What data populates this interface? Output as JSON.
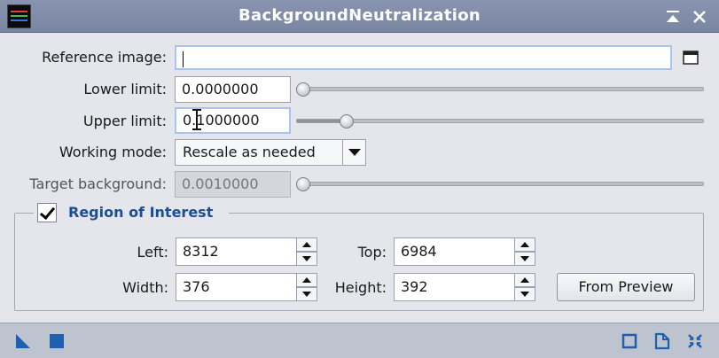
{
  "window": {
    "title": "BackgroundNeutralization"
  },
  "form": {
    "reference_image": {
      "label": "Reference image:",
      "value": ""
    },
    "lower_limit": {
      "label": "Lower limit:",
      "value": "0.0000000"
    },
    "upper_limit": {
      "label": "Upper limit:",
      "value": "0.1000000"
    },
    "working_mode": {
      "label": "Working mode:",
      "value": "Rescale as needed"
    },
    "target_background": {
      "label": "Target background:",
      "value": "0.0010000"
    }
  },
  "sliders": {
    "lower_limit_position": 0.0,
    "upper_limit_position": 0.11,
    "target_background_position": 0.0
  },
  "roi": {
    "title": "Region of Interest",
    "checked": true,
    "left": {
      "label": "Left:",
      "value": "8312"
    },
    "top": {
      "label": "Top:",
      "value": "6984"
    },
    "width": {
      "label": "Width:",
      "value": "376"
    },
    "height": {
      "label": "Height:",
      "value": "392"
    },
    "from_preview_label": "From Preview"
  },
  "colors": {
    "titlebar": "#7b86a3",
    "group_title": "#1c4e94",
    "accent_icon": "#1f5fb0"
  },
  "icons": {
    "titlebar": [
      "app-icon",
      "shade-icon",
      "close-icon"
    ],
    "bottom_left": [
      "new-instance-icon",
      "apply-global-icon"
    ],
    "bottom_right": [
      "apply-icon",
      "browse-documentation-icon",
      "reset-icon"
    ]
  }
}
